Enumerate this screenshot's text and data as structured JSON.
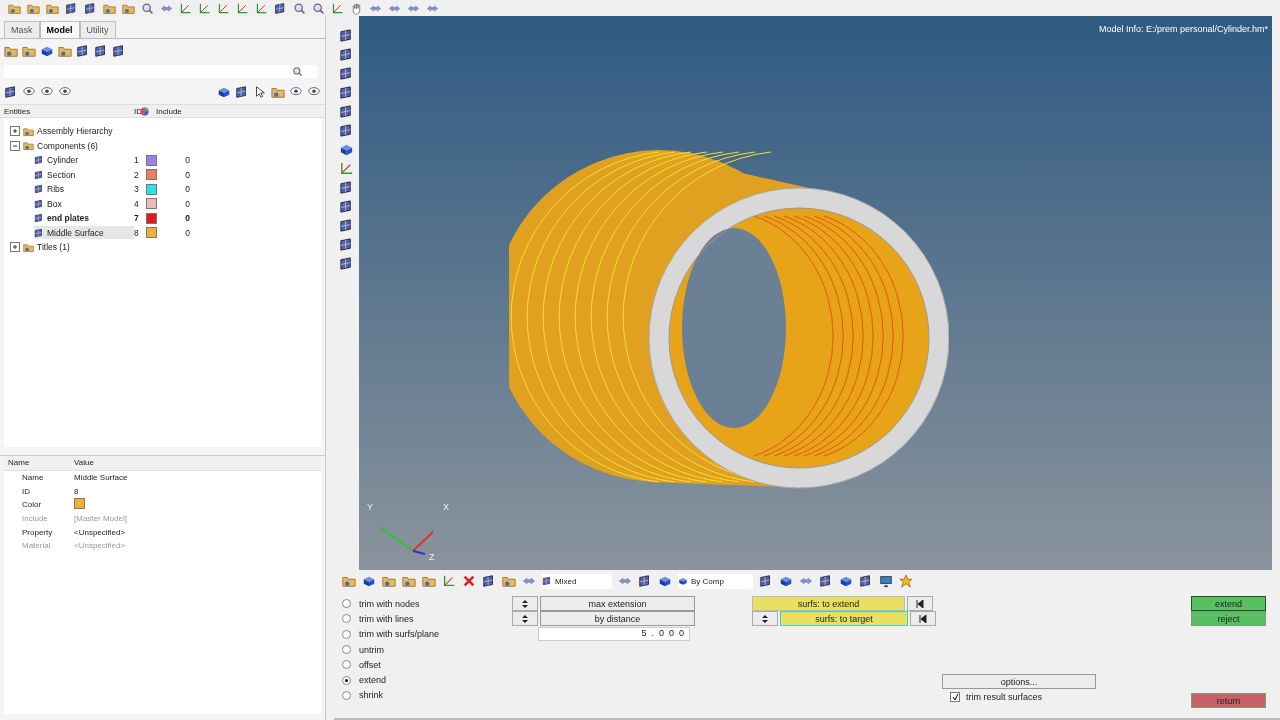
{
  "panel_tabs": [
    {
      "label": "Mask",
      "selected": false
    },
    {
      "label": "Model",
      "selected": true
    },
    {
      "label": "Utility",
      "selected": false
    }
  ],
  "entity_columns": [
    "Entities",
    "ID",
    "Include"
  ],
  "tree": [
    {
      "label": "Assembly Hierarchy",
      "expanded": false
    },
    {
      "label": "Components (6)",
      "expanded": true,
      "children": [
        {
          "name": "Cylinder",
          "id": "1",
          "color": "#9b80e6",
          "include": "0",
          "bold": false,
          "selected": false
        },
        {
          "name": "Section",
          "id": "2",
          "color": "#ea8060",
          "include": "0",
          "bold": false,
          "selected": false
        },
        {
          "name": "Ribs",
          "id": "3",
          "color": "#30e0e0",
          "include": "0",
          "bold": false,
          "selected": false
        },
        {
          "name": "Box",
          "id": "4",
          "color": "#f0b8b8",
          "include": "0",
          "bold": false,
          "selected": false
        },
        {
          "name": "end plates",
          "id": "7",
          "color": "#e81818",
          "include": "0",
          "bold": true,
          "selected": false
        },
        {
          "name": "Middle Surface",
          "id": "8",
          "color": "#f0b030",
          "include": "0",
          "bold": false,
          "selected": true
        }
      ]
    },
    {
      "label": "Titles (1)",
      "expanded": false
    }
  ],
  "properties": {
    "columns": [
      "Name",
      "Value"
    ],
    "rows": [
      {
        "name": "Name",
        "kind": "text",
        "value": "Middle Surface",
        "disabled": false
      },
      {
        "name": "ID",
        "kind": "text",
        "value": "8",
        "disabled": false
      },
      {
        "name": "Color",
        "kind": "swatch",
        "color": "#f0b030",
        "disabled": false
      },
      {
        "name": "Include",
        "kind": "text",
        "value": "[Master Model]",
        "disabled": true
      },
      {
        "name": "Property",
        "kind": "text",
        "value": "<Unspecified>",
        "disabled": false
      },
      {
        "name": "Material",
        "kind": "text",
        "value": "<Unspecified>",
        "disabled": true
      }
    ]
  },
  "viewport": {
    "model_info": "Model Info: E:/prem personal/Cylinder.hm*",
    "axes": [
      "Y",
      "X",
      "Z"
    ]
  },
  "bottom_toolbar": {
    "selectors": [
      "Mixed",
      "By Comp"
    ]
  },
  "panel": {
    "modes": [
      {
        "label": "trim with nodes",
        "selected": false
      },
      {
        "label": "trim with lines",
        "selected": false
      },
      {
        "label": "trim with surfs/plane",
        "selected": false
      },
      {
        "label": "untrim",
        "selected": false
      },
      {
        "label": "offset",
        "selected": false
      },
      {
        "label": "extend",
        "selected": true
      },
      {
        "label": "shrink",
        "selected": false
      }
    ],
    "methods": [
      "max extension",
      "by distance"
    ],
    "distance": "5.000",
    "collectors": [
      {
        "label": "surfs: to extend",
        "active": false
      },
      {
        "label": "surfs: to target",
        "active": true
      }
    ],
    "options": "options...",
    "trim_result": {
      "label": "trim result surfaces",
      "checked": true
    },
    "actions": [
      {
        "label": "extend",
        "kind": "go",
        "default": true
      },
      {
        "label": "reject",
        "kind": "go",
        "default": false
      },
      {
        "label": "return",
        "kind": "exit",
        "default": false
      }
    ]
  }
}
